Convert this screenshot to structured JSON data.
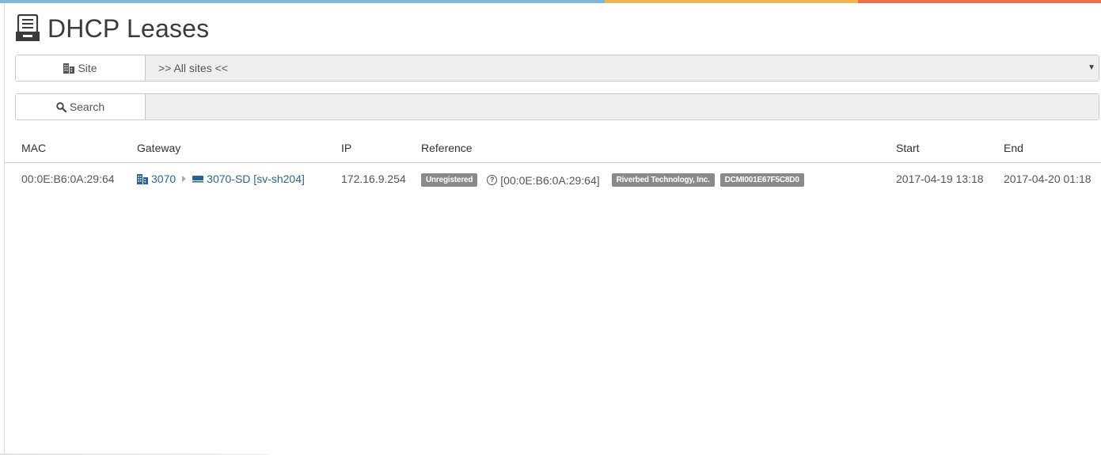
{
  "page": {
    "title": "DHCP Leases"
  },
  "filters": {
    "site": {
      "label": "Site",
      "value": ">> All sites <<"
    },
    "search": {
      "label": "Search",
      "value": ""
    }
  },
  "table": {
    "columns": [
      "MAC",
      "Gateway",
      "IP",
      "Reference",
      "Start",
      "End"
    ],
    "rows": [
      {
        "mac": "00:0E:B6:0A:29:64",
        "gateway_site": "3070",
        "gateway_device": "3070-SD [sv-sh204]",
        "ip": "172.16.9.254",
        "status_badge": "Unregistered",
        "reference_mac": "[00:0E:B6:0A:29:64]",
        "vendor_badge": "Riverbed Technology, Inc.",
        "host_badge": "DCMI001E67F5C8D0",
        "start": "2017-04-19 13:18",
        "end": "2017-04-20 01:18"
      }
    ]
  },
  "colors": {
    "link": "#2a6496",
    "badge": "#8a8a8a",
    "stripe_blue": "#7fb6dc",
    "stripe_yellow": "#f1b553",
    "stripe_orange": "#e8734a"
  }
}
